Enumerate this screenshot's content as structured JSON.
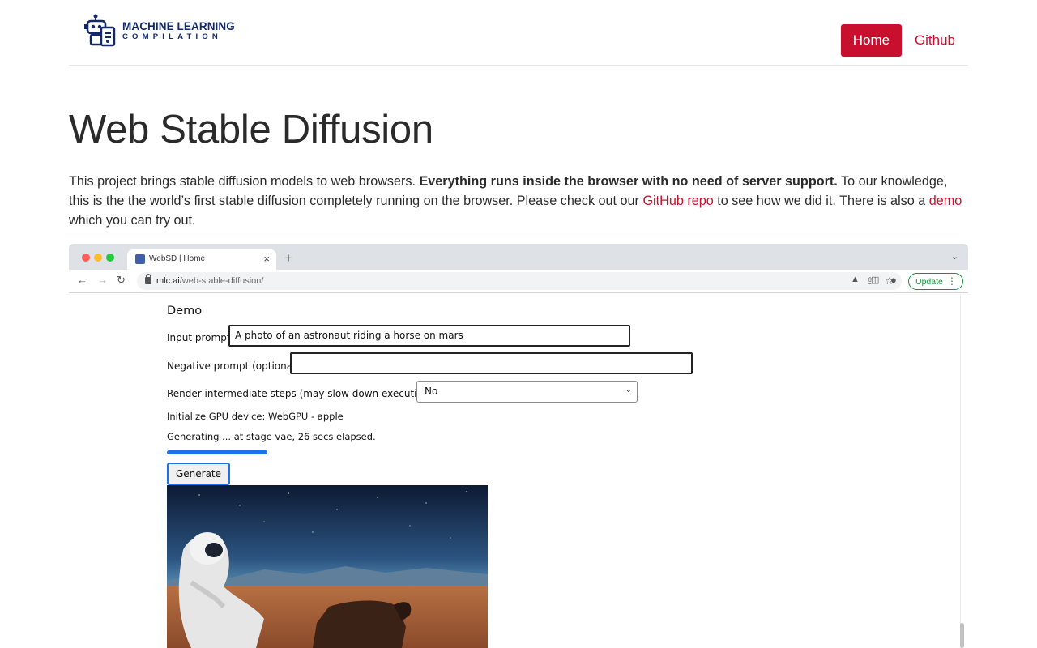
{
  "header": {
    "logo": {
      "line1": "MACHINE LEARNING",
      "line2": "COMPILATION"
    },
    "nav": {
      "home": "Home",
      "github": "Github"
    }
  },
  "article": {
    "title": "Web Stable Diffusion",
    "intro": {
      "part1": "This project brings stable diffusion models to web browsers. ",
      "bold": "Everything runs inside the browser with no need of server support.",
      "part2": " To our knowledge, this is the the world’s first stable diffusion completely running on the browser. Please check out our ",
      "link_repo": "GitHub repo",
      "part3": " to see how we did it. There is also a ",
      "link_demo": "demo",
      "part4": " which you can try out."
    }
  },
  "screenshot": {
    "tab": {
      "title": "WebSD | Home",
      "close": "×",
      "new_tab": "+"
    },
    "toolbar": {
      "url_host": "mlc.ai",
      "url_path": "/web-stable-diffusion/",
      "update_label": "Update"
    },
    "demo": {
      "heading": "Demo",
      "input_prompt_label": "Input prompt:",
      "input_prompt_value": "A photo of an astronaut riding a horse on mars",
      "negative_prompt_label": "Negative prompt (optional):",
      "negative_prompt_value": "",
      "render_steps_label": "Render intermediate steps (may slow down execution) -",
      "render_steps_value": "No",
      "gpu_status": "Initialize GPU device: WebGPU - apple",
      "progress_status": "Generating ... at stage vae, 26 secs elapsed.",
      "progress_value": 0.25,
      "generate_label": "Generate"
    }
  },
  "colors": {
    "brand_red": "#c8102e",
    "logo_navy": "#12286b",
    "progress_blue": "#1a73e8",
    "update_green": "#1e8e3e"
  },
  "icons": [
    "robot-logo-icon",
    "back-arrow-icon",
    "forward-arrow-icon",
    "reload-icon",
    "lock-icon",
    "share-icon",
    "star-icon",
    "labs-icon",
    "sidepanel-icon",
    "profile-icon",
    "kebab-menu-icon",
    "chevron-down-icon"
  ]
}
